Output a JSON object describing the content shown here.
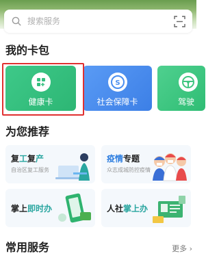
{
  "search": {
    "placeholder": "搜索服务",
    "icon": "search-icon",
    "scan_icon": "scan-icon"
  },
  "sections": {
    "my_cards": "我的卡包",
    "recommended": "为您推荐",
    "common_services": "常用服务",
    "more": "更多"
  },
  "cards": [
    {
      "label": "健康卡",
      "icon": "health-card-icon",
      "color": "#3ec989",
      "selected": true
    },
    {
      "label": "社会保障卡",
      "icon": "social-security-icon",
      "color": "#4a8ef0"
    },
    {
      "label": "驾驶",
      "icon": "steering-wheel-icon",
      "color": "#3fc680"
    }
  ],
  "recommendations": [
    {
      "title_a": "复",
      "title_b": "工",
      "title_c": "复",
      "title_d": "产",
      "subtitle": "自治区复工服务"
    },
    {
      "title_a": "疫情",
      "title_b": "专题",
      "subtitle": "众志成城防控疫情"
    },
    {
      "title_a": "掌上",
      "title_b": "即时办",
      "subtitle": ""
    },
    {
      "title_a": "人社",
      "title_b": "掌上办",
      "subtitle": ""
    }
  ]
}
